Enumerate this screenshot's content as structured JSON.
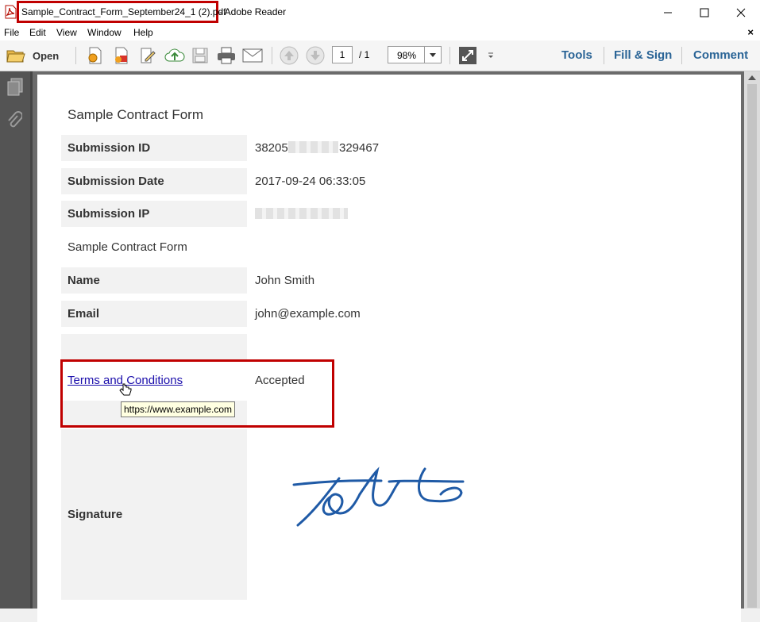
{
  "window": {
    "file_name": "Sample_Contract_Form_September24_1 (2).pdf",
    "app_suffix": " - Adobe Reader"
  },
  "menu": [
    "File",
    "Edit",
    "View",
    "Window",
    "Help"
  ],
  "toolbar": {
    "open_label": "Open",
    "page_current": "1",
    "page_total": "/ 1",
    "zoom": "98%",
    "tools_label": "Tools",
    "fill_sign_label": "Fill & Sign",
    "comment_label": "Comment"
  },
  "document": {
    "form_title": "Sample Contract Form",
    "rows": [
      {
        "label": "Submission ID",
        "value_prefix": "38205",
        "value_suffix": "329467"
      },
      {
        "label": "Submission Date",
        "value": "2017-09-24 06:33:05"
      },
      {
        "label": "Submission IP",
        "value": ""
      }
    ],
    "section_title": "Sample Contract Form",
    "name_label": "Name",
    "name_value": "John Smith",
    "email_label": "Email",
    "email_value": "john@example.com",
    "tc_link": "Terms and Conditions",
    "tc_value": "Accepted",
    "tooltip_url": "https://www.example.com",
    "signature_label": "Signature"
  },
  "colors": {
    "highlight": "#c00000",
    "link": "#1a0dab",
    "signature_ink": "#1f5aa6",
    "toolbar_accent": "#2a6496"
  }
}
